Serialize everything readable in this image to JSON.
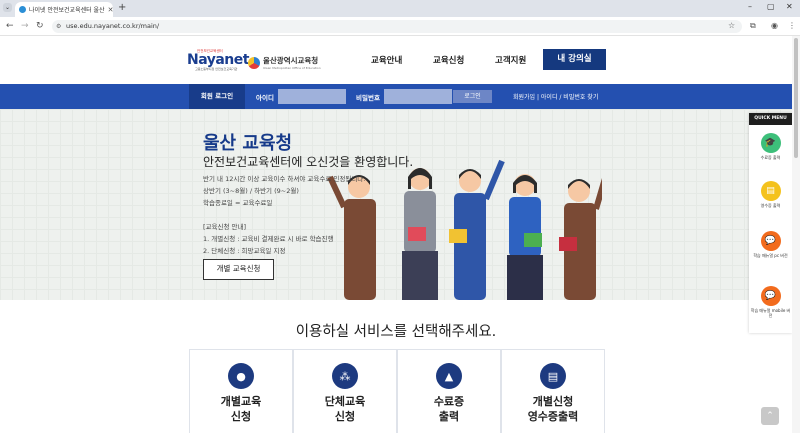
{
  "browser": {
    "tab_title": "나이넷 안전보건교육센터 울산",
    "url": "use.edu.nayanet.co.kr/main/"
  },
  "header": {
    "logo_main": "Nayanet",
    "logo_sub": "안전보건교육센터",
    "logo_sub2": "고용노동부지정 안전보건교육기관",
    "partner_title": "울산광역시교육청",
    "partner_sub": "Ulsan Metropolitan Office of Education",
    "nav": [
      "교육안내",
      "교육신청",
      "고객지원",
      "내 강의실"
    ]
  },
  "login": {
    "title": "회원 로그인",
    "id_label": "아이디",
    "pw_label": "비밀번호",
    "button": "로그인",
    "links": "회원가입 | 아이디 / 비밀번호 찾기"
  },
  "hero": {
    "title": "울산 교육청",
    "subtitle": "안전보건교육센터에 오신것을 환영합니다.",
    "lines": [
      "반기 내 12시간 이상 교육이수 하셔야 교육수료 인정됩니다.",
      "상반기 (3~8월) / 하반기 (9~2월)",
      "학습종료일 = 교육수료일",
      "[교육신청 안내]",
      "1. 개별신청 : 교육비 결제완료 시 바로 학습진행",
      "2. 단체신청 : 희망교육일 지정"
    ],
    "button": "개별 교육신청"
  },
  "quick_menu": {
    "title": "QUICK MENU",
    "items": [
      {
        "label": "수료증 출력",
        "color": "#3dbf7a",
        "icon": "graduation-cap-icon"
      },
      {
        "label": "영수증 출력",
        "color": "#f4c21d",
        "icon": "receipt-icon"
      },
      {
        "label": "학습 매뉴얼 pc 버전",
        "color": "#f26b1d",
        "icon": "chat-bubble-icon"
      },
      {
        "label": "학습 매뉴얼 mobile 버전",
        "color": "#f26b1d",
        "icon": "chat-bubble-icon"
      }
    ]
  },
  "services": {
    "title": "이용하실 서비스를 선택해주세요.",
    "items": [
      {
        "label": "개별교육\n신청",
        "icon": "person-icon"
      },
      {
        "label": "단체교육\n신청",
        "icon": "group-icon"
      },
      {
        "label": "수료증\n출력",
        "icon": "graduation-cap-icon"
      },
      {
        "label": "개별신청\n영수증출력",
        "icon": "receipt-icon"
      }
    ]
  },
  "colors": {
    "brand": "#15397f",
    "bar": "#2450b0"
  }
}
